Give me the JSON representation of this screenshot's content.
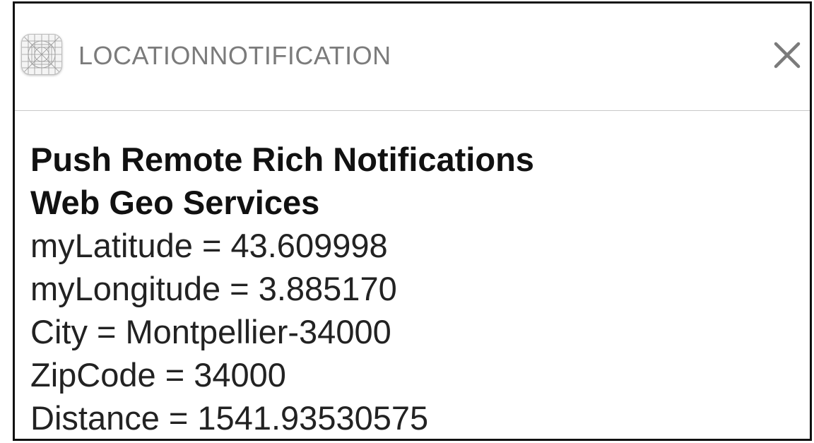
{
  "notification": {
    "app_name": "LOCATIONNOTIFICATION",
    "app_icon": "app-placeholder-grid-icon",
    "close_icon": "close-icon",
    "title_lines": [
      "Push Remote Rich Notifications",
      "Web Geo Services"
    ],
    "body_lines": [
      "myLatitude = 43.609998",
      "myLongitude = 3.885170",
      "City = Montpellier-34000",
      "ZipCode = 34000",
      "Distance = 1541.93530575"
    ]
  },
  "colors": {
    "app_name": "#7b7b7b",
    "text": "#111111",
    "border": "#111111",
    "divider": "#c8c8c8"
  }
}
